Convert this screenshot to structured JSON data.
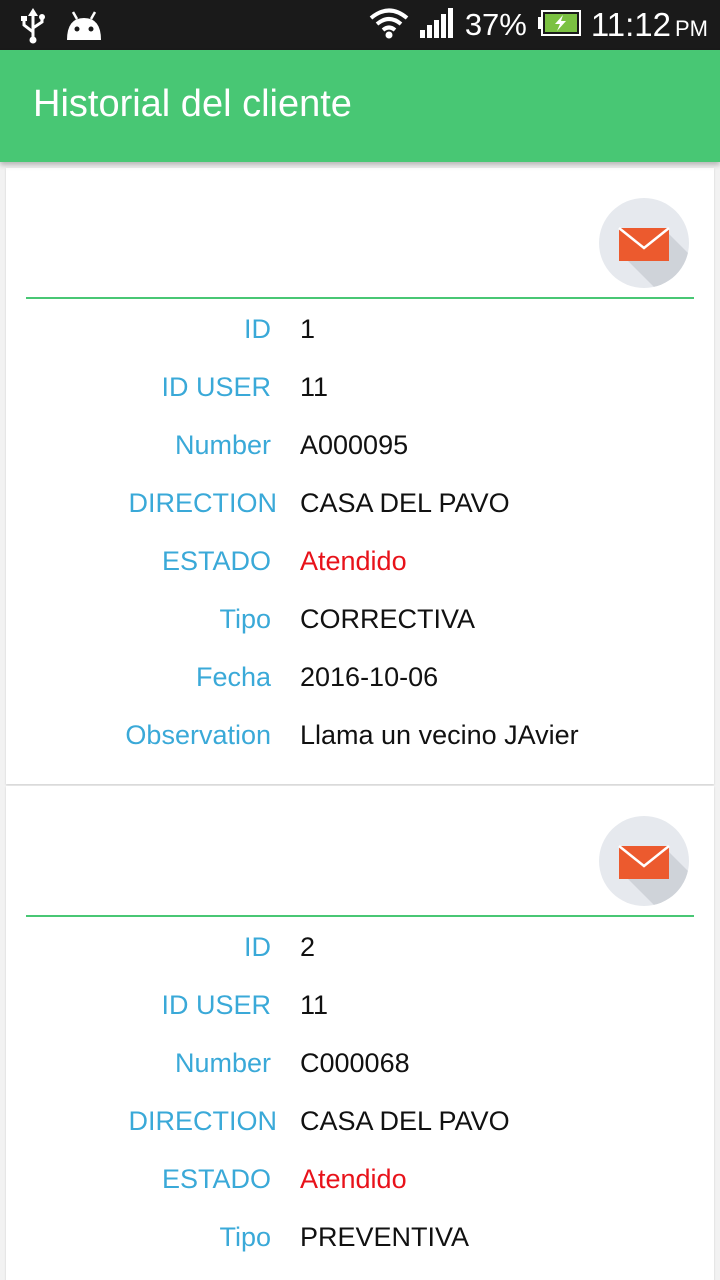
{
  "status_bar": {
    "battery_percent": "37%",
    "time": "11:12",
    "ampm": "PM",
    "icons": [
      "usb-icon",
      "android-icon",
      "wifi-icon",
      "signal-icon",
      "battery-charging-icon"
    ]
  },
  "app_bar": {
    "title": "Historial del cliente",
    "color": "#48c774"
  },
  "colors": {
    "label": "#3aa9d8",
    "estado_value": "#e8121a",
    "mail_icon": "#ec5a2e"
  },
  "records": [
    {
      "fields": [
        {
          "label": "ID",
          "value": "1"
        },
        {
          "label": "ID USER",
          "value": "11"
        },
        {
          "label": "Number",
          "value": "A000095"
        },
        {
          "label": "DIRECTION",
          "value": "CASA DEL PAVO"
        },
        {
          "label": "ESTADO",
          "value": "Atendido"
        },
        {
          "label": "Tipo",
          "value": "CORRECTIVA"
        },
        {
          "label": "Fecha",
          "value": "2016-10-06"
        },
        {
          "label": "Observation",
          "value": "Llama un vecino JAvier"
        }
      ]
    },
    {
      "fields": [
        {
          "label": "ID",
          "value": "2"
        },
        {
          "label": "ID USER",
          "value": "11"
        },
        {
          "label": "Number",
          "value": "C000068"
        },
        {
          "label": "DIRECTION",
          "value": "CASA DEL PAVO"
        },
        {
          "label": "ESTADO",
          "value": "Atendido"
        },
        {
          "label": "Tipo",
          "value": "PREVENTIVA"
        }
      ]
    }
  ]
}
